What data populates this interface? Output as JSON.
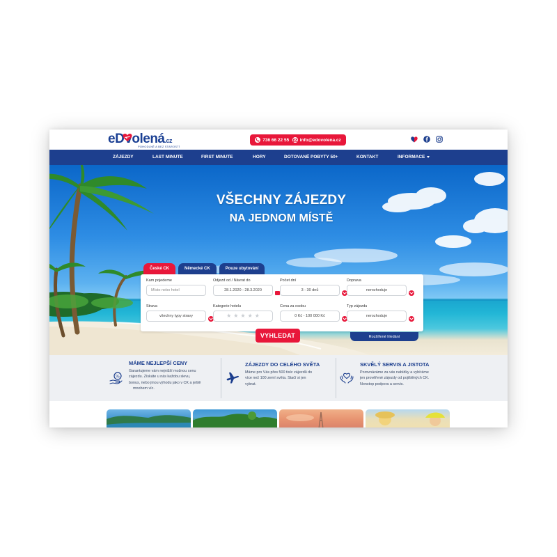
{
  "brand": {
    "logo_main": "eD",
    "logo_rest": "volená",
    "logo_tld": ".cz",
    "logo_tagline": "POHODLNĚ A BEZ STAROSTÍ",
    "primary_color": "#1d3f8e",
    "accent_color": "#e8173a"
  },
  "contact": {
    "phone": "736 66 22 55",
    "email": "info@edovolena.cz"
  },
  "socials": [
    "heart-badge-icon",
    "facebook-icon",
    "instagram-icon"
  ],
  "nav": {
    "items": [
      {
        "label": "ZÁJEZDY"
      },
      {
        "label": "LAST MINUTE"
      },
      {
        "label": "FIRST MINUTE"
      },
      {
        "label": "HORY"
      },
      {
        "label": "DOTOVANÉ POBYTY 50+"
      },
      {
        "label": "KONTAKT"
      },
      {
        "label": "INFORMACE"
      }
    ]
  },
  "hero": {
    "title_line1": "VŠECHNY ZÁJEZDY",
    "title_line2": "NA JEDNOM MÍSTĚ"
  },
  "search": {
    "tabs": [
      {
        "label": "České CK",
        "active": true
      },
      {
        "label": "Německé CK",
        "active": false
      },
      {
        "label": "Pouze ubytování",
        "active": false
      }
    ],
    "fields": {
      "destination": {
        "label": "Kam pojedeme",
        "placeholder": "Místo nebo hotel"
      },
      "dates": {
        "label": "Odjezd od / Návrat do",
        "value": "28.1.2020 - 28.3.2020"
      },
      "days": {
        "label": "Počet dní",
        "value": "3 - 30 dnů"
      },
      "transport": {
        "label": "Doprava",
        "value": "nerozhoduje"
      },
      "board": {
        "label": "Strava",
        "value": "všechny typy stravy"
      },
      "hotel_category": {
        "label": "Kategorie hotelu",
        "stars": 5
      },
      "price": {
        "label": "Cena za osobu",
        "value": "0 Kč - 100 000 Kč"
      },
      "trip_type": {
        "label": "Typ zájezdu",
        "value": "nerozhoduje"
      }
    },
    "submit_label": "VYHLEDAT",
    "advanced_label": "Rozšířené hledání"
  },
  "features": [
    {
      "title": "MÁME NEJLEPŠÍ CENY",
      "icon": "hand-percent-icon",
      "lines": [
        "Garantujeme vám nejnižší možnou cenu",
        "zájezdu. Získáte u nás každou slevu,",
        "bonus, nebo jinou výhodu jako v CK a ještě",
        "mnohem víc."
      ]
    },
    {
      "title": "ZÁJEZDY DO CELÉHO SVĚTA",
      "icon": "airplane-icon",
      "lines": [
        "Máme pro Vás přes 500 tisíc zájezdů do",
        "více než 100 zemí světa. Stačí si jen",
        "vybrat."
      ]
    },
    {
      "title": "SKVĚLÝ SERVIS A JISTOTA",
      "icon": "care-hands-icon",
      "lines": [
        "Porovnáváme za vás nabídky a vybíráme",
        "jen prověřené zájezdy od pojištěných CK.",
        "Nonstop podpora a servis."
      ]
    }
  ]
}
